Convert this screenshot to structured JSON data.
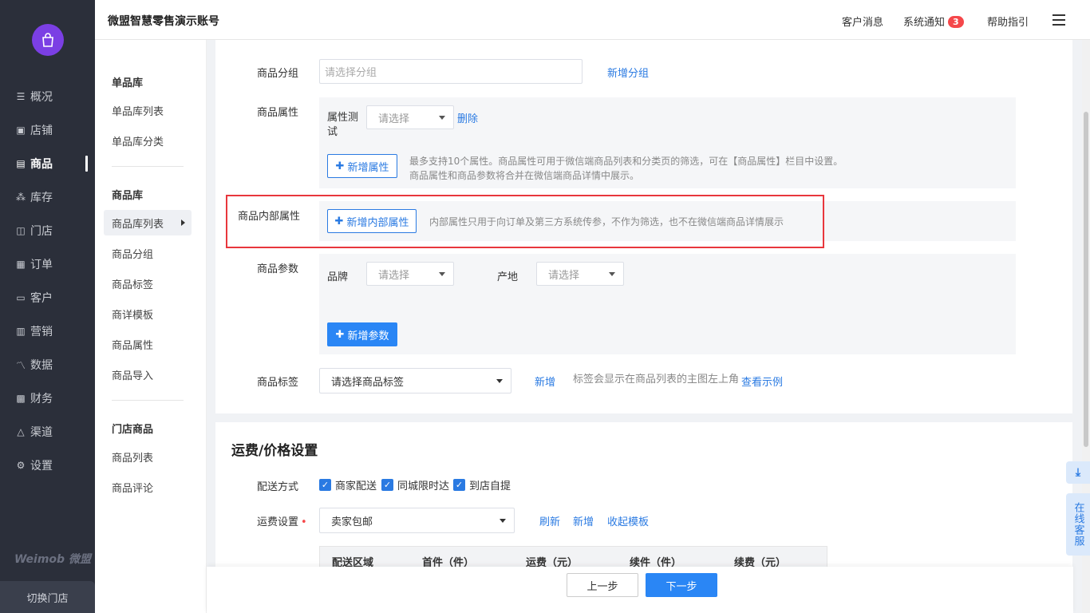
{
  "header": {
    "title": "微盟智慧零售演示账号",
    "customer_msg": "客户消息",
    "notice": "系统通知",
    "notice_count": "3",
    "help": "帮助指引"
  },
  "nav": {
    "items": [
      "概况",
      "店铺",
      "商品",
      "库存",
      "门店",
      "订单",
      "客户",
      "营销",
      "数据",
      "财务",
      "渠道",
      "设置"
    ],
    "active": "商品",
    "brand": "Weimob 微盟",
    "switch_store": "切换门店"
  },
  "sub_nav": {
    "group1": "单品库",
    "group1_items": [
      "单品库列表",
      "单品库分类"
    ],
    "group2": "商品库",
    "group2_items": [
      "商品库列表",
      "商品分组",
      "商品标签",
      "商详模板",
      "商品属性",
      "商品导入"
    ],
    "group3": "门店商品",
    "group3_items": [
      "商品列表",
      "商品评论"
    ]
  },
  "form": {
    "group_label": "商品分组",
    "group_placeholder": "请选择分组",
    "group_add": "新增分组",
    "attr_label": "商品属性",
    "attr_name": "属性测试",
    "attr_select": "请选择",
    "attr_delete": "删除",
    "attr_add": "新增属性",
    "attr_hint_1": "最多支持10个属性。商品属性可用于微信端商品列表和分类页的筛选，可在【商品属性】栏目中设置。",
    "attr_hint_2": "商品属性和商品参数将合并在微信端商品详情中展示。",
    "inner_label": "商品内部属性",
    "inner_add": "新增内部属性",
    "inner_hint": "内部属性只用于向订单及第三方系统传参，不作为筛选，也不在微信端商品详情展示",
    "param_label": "商品参数",
    "brand_label": "品牌",
    "brand_select": "请选择",
    "origin_label": "产地",
    "origin_select": "请选择",
    "param_add": "新增参数",
    "tag_label": "商品标签",
    "tag_select": "请选择商品标签",
    "tag_add": "新增",
    "tag_hint": "标签会显示在商品列表的主图左上角",
    "tag_example": "查看示例"
  },
  "shipping": {
    "title": "运费/价格设置",
    "delivery_label": "配送方式",
    "options": [
      "商家配送",
      "同城限时达",
      "到店自提"
    ],
    "fee_label": "运费设置",
    "fee_select": "卖家包邮",
    "refresh": "刷新",
    "add": "新增",
    "collapse": "收起模板",
    "table_headers": [
      "配送区域",
      "首件（件）",
      "运费（元）",
      "续件（件）",
      "续费（元）"
    ]
  },
  "footer": {
    "prev": "上一步",
    "next": "下一步"
  },
  "float": {
    "service": "在线客服"
  }
}
